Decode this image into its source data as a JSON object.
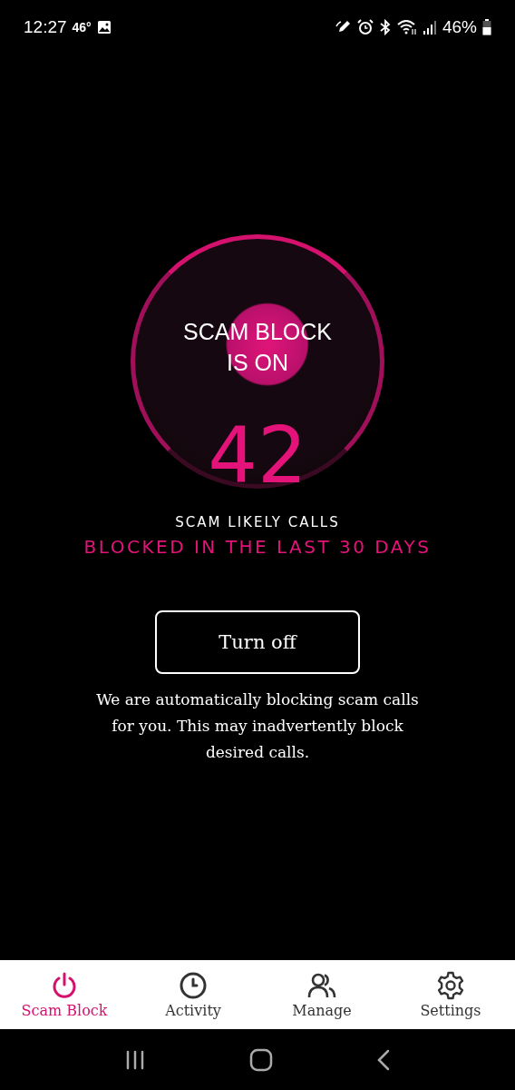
{
  "status_bar": {
    "time": "12:27",
    "temperature": "46°",
    "battery": "46%"
  },
  "status": {
    "title": "SCAM BLOCK IS ON",
    "count": "42",
    "count_label": "SCAM LIKELY CALLS",
    "period": "BLOCKED IN THE LAST 30 DAYS"
  },
  "action": {
    "label": "Turn off"
  },
  "description": "We are automatically blocking scam calls for you. This may inadvertently block desired calls.",
  "tabs": [
    {
      "label": "Scam Block",
      "selected": true
    },
    {
      "label": "Activity",
      "selected": false
    },
    {
      "label": "Manage",
      "selected": false
    },
    {
      "label": "Settings",
      "selected": false
    }
  ]
}
